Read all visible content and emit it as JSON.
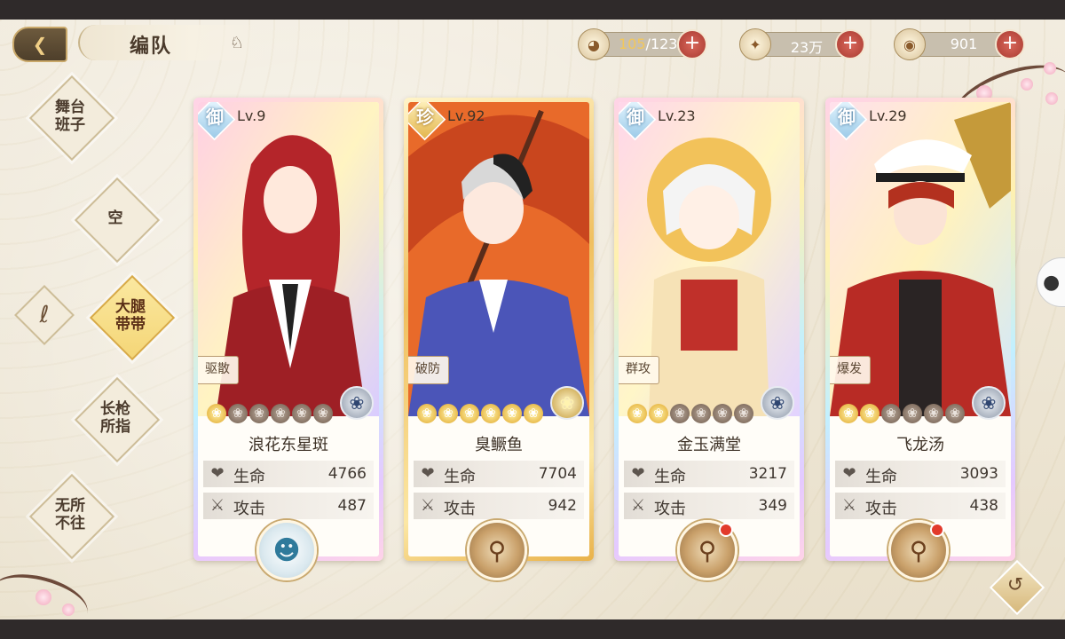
{
  "header": {
    "title": "编队",
    "back_icon": "back-arrow-icon",
    "title_icon": "crown-icon"
  },
  "resources": {
    "stamina": {
      "current": "105",
      "max": "/123",
      "icon": "bowl-icon"
    },
    "coins": {
      "value": "23万",
      "icon": "coin-icon"
    },
    "gems": {
      "value": "901",
      "icon": "gem-icon"
    }
  },
  "menu": {
    "items": [
      {
        "label": "舞台\n班子",
        "active": false
      },
      {
        "label": "空",
        "active": false
      },
      {
        "label": "大腿\n带带",
        "active": true
      },
      {
        "label": "长枪\n所指",
        "active": false
      },
      {
        "label": "无所\n不往",
        "active": false
      }
    ],
    "logo_icon": "brand-logo-icon"
  },
  "cards": [
    {
      "rank": "御",
      "level": "Lv.9",
      "role": "驱散",
      "name": "浪花东星斑",
      "stars_on": 1,
      "stars_total": 6,
      "hp_label": "生命",
      "hp": "4766",
      "atk_label": "攻击",
      "atk": "487",
      "has_dot": false,
      "avatar": true
    },
    {
      "rank": "珍",
      "level": "Lv.92",
      "role": "破防",
      "name": "臭鳜鱼",
      "stars_on": 6,
      "stars_total": 6,
      "hp_label": "生命",
      "hp": "7704",
      "atk_label": "攻击",
      "atk": "942",
      "has_dot": false,
      "avatar": false
    },
    {
      "rank": "御",
      "level": "Lv.23",
      "role": "群攻",
      "name": "金玉满堂",
      "stars_on": 2,
      "stars_total": 6,
      "hp_label": "生命",
      "hp": "3217",
      "atk_label": "攻击",
      "atk": "349",
      "has_dot": true,
      "avatar": false
    },
    {
      "rank": "御",
      "level": "Lv.29",
      "role": "爆发",
      "name": "飞龙汤",
      "stars_on": 2,
      "stars_total": 6,
      "hp_label": "生命",
      "hp": "3093",
      "atk_label": "攻击",
      "atk": "438",
      "has_dot": true,
      "avatar": false
    }
  ],
  "colors": {
    "accent": "#d8aa46",
    "plus": "#b9473c",
    "background": "#ede6d4"
  }
}
